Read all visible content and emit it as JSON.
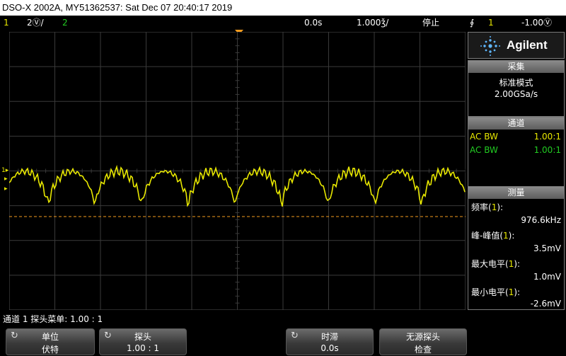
{
  "title": "DSO-X 2002A, MY51362537: Sat Dec 07 20:40:17 2019",
  "status": {
    "ch1_num": "1",
    "ch1_scale": "2Ⓥ/",
    "ch2_num": "2",
    "time_pos": "0.0s",
    "time_scale": "1.000ǯ/",
    "run_state": "停止",
    "trig_icon": "∮",
    "trig_ch": "1",
    "trig_level": "-1.00Ⓥ"
  },
  "left_markers": {
    "ch1": "1▸",
    "trig": "▸",
    "level": "▸"
  },
  "panel": {
    "brand": "Agilent",
    "acquire": {
      "header": "采集",
      "mode": "标准模式",
      "rate": "2.00GSa/s"
    },
    "channel": {
      "header": "通道",
      "rows": [
        {
          "label": "AC BW",
          "value": "1.00:1"
        },
        {
          "label": "AC BW",
          "value": "1.00:1"
        }
      ]
    },
    "measure": {
      "header": "测量",
      "items": [
        {
          "label": "频率(",
          "ch": "1",
          "end": "):",
          "value": "976.6kHz"
        },
        {
          "label": "峰-峰值(",
          "ch": "1",
          "end": "):",
          "value": "3.5mV"
        },
        {
          "label": "最大电平(",
          "ch": "1",
          "end": "):",
          "value": "1.0mV"
        },
        {
          "label": "最小电平(",
          "ch": "1",
          "end": "):",
          "value": "-2.6mV"
        }
      ]
    }
  },
  "probe_menu": "通道 1 探头菜单: 1.00 : 1",
  "softkeys": [
    {
      "line1": "单位",
      "line2": "伏特"
    },
    {
      "line1": "探头",
      "line2": "1.00 : 1"
    },
    {
      "line1": "时滞",
      "line2": "0.0s"
    },
    {
      "line1": "无源探头",
      "line2": "检查"
    }
  ],
  "colors": {
    "ch1": "#e8e800",
    "ch2": "#22cc22",
    "trigger": "#f39b1e",
    "grid": "#3a3a3a"
  }
}
